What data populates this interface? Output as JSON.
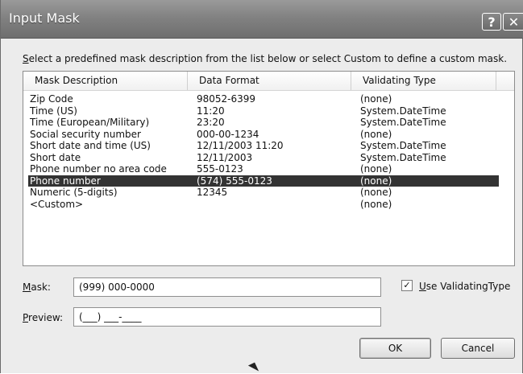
{
  "window": {
    "title": "Input Mask",
    "help_glyph": "?",
    "close_glyph": "✕"
  },
  "instruction": "Select a predefined mask description from the list below or select Custom to define a custom mask.",
  "list": {
    "columns": [
      "Mask Description",
      "Data Format",
      "Validating Type"
    ],
    "rows": [
      {
        "description": "Zip Code",
        "format": "98052-6399",
        "type": "(none)"
      },
      {
        "description": "Time (US)",
        "format": "11:20",
        "type": "System.DateTime"
      },
      {
        "description": "Time (European/Military)",
        "format": "23:20",
        "type": "System.DateTime"
      },
      {
        "description": "Social security number",
        "format": "000-00-1234",
        "type": "(none)"
      },
      {
        "description": "Short date and time (US)",
        "format": "12/11/2003 11:20",
        "type": "System.DateTime"
      },
      {
        "description": "Short date",
        "format": "12/11/2003",
        "type": "System.DateTime"
      },
      {
        "description": "Phone number no area code",
        "format": "555-0123",
        "type": "(none)"
      },
      {
        "description": "Phone number",
        "format": "(574) 555-0123",
        "type": "(none)"
      },
      {
        "description": "Numeric (5-digits)",
        "format": "12345",
        "type": "(none)"
      },
      {
        "description": "<Custom>",
        "format": "",
        "type": "(none)"
      }
    ],
    "selected_index": 7
  },
  "mask": {
    "label": "Mask:",
    "value": "(999) 000-0000"
  },
  "preview": {
    "label": "Preview:",
    "value": "(___) ___-____"
  },
  "use_validating_type": {
    "label": "Use ValidatingType",
    "checked": true,
    "check_glyph": "✓"
  },
  "buttons": {
    "ok": "OK",
    "cancel": "Cancel"
  }
}
